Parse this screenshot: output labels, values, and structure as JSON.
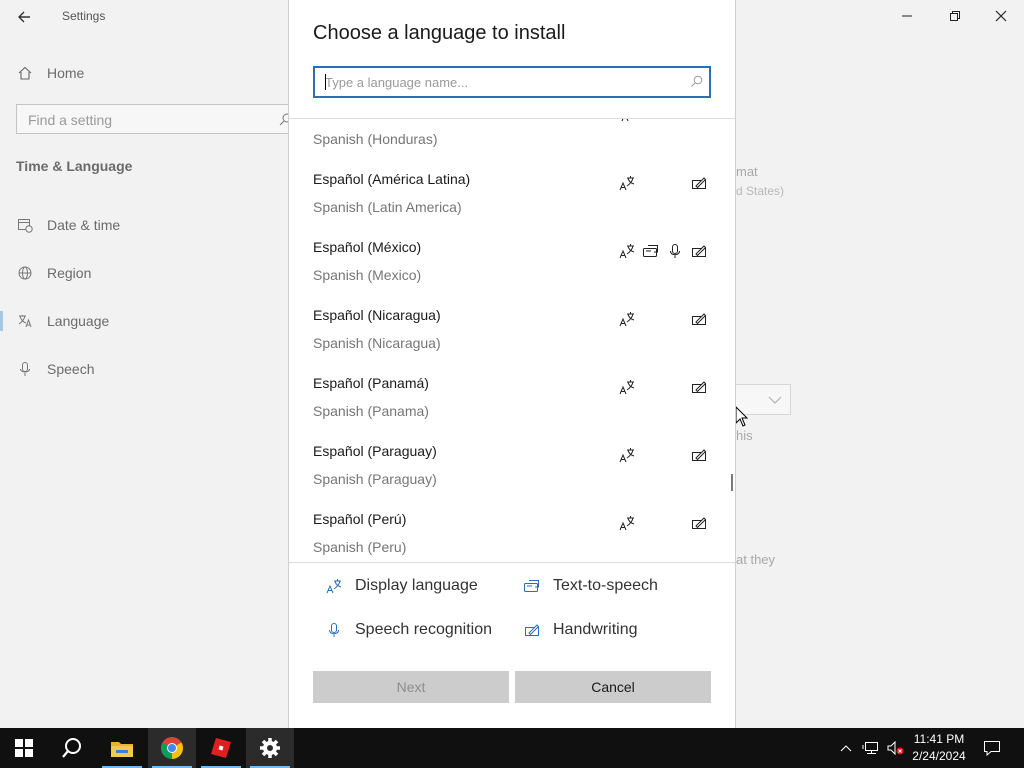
{
  "app": {
    "title": "Settings"
  },
  "sidebar": {
    "home_label": "Home",
    "find_placeholder": "Find a setting",
    "section_title": "Time & Language",
    "items": [
      {
        "label": "Date & time",
        "icon": "calendar-clock-icon"
      },
      {
        "label": "Region",
        "icon": "globe-icon"
      },
      {
        "label": "Language",
        "icon": "language-icon",
        "selected": true
      },
      {
        "label": "Speech",
        "icon": "microphone-icon"
      }
    ]
  },
  "background": {
    "fragment_format": "mat",
    "fragment_states": "d States)",
    "fragment_this": "his",
    "fragment_they": "at they"
  },
  "dialog": {
    "title": "Choose a language to install",
    "search_placeholder": "Type a language name...",
    "languages": [
      {
        "native": "",
        "english": "Spanish (Honduras)"
      },
      {
        "native": "Español (América Latina)",
        "english": "Spanish (Latin America)",
        "features": [
          "display",
          "handwriting"
        ]
      },
      {
        "native": "Español (México)",
        "english": "Spanish (Mexico)",
        "features": [
          "display",
          "tts",
          "speech",
          "handwriting"
        ]
      },
      {
        "native": "Español (Nicaragua)",
        "english": "Spanish (Nicaragua)",
        "features": [
          "display",
          "handwriting"
        ]
      },
      {
        "native": "Español (Panamá)",
        "english": "Spanish (Panama)",
        "features": [
          "display",
          "handwriting"
        ]
      },
      {
        "native": "Español (Paraguay)",
        "english": "Spanish (Paraguay)",
        "features": [
          "display",
          "handwriting"
        ]
      },
      {
        "native": "Español (Perú)",
        "english": "Spanish (Peru)",
        "features": [
          "display",
          "handwriting"
        ]
      }
    ],
    "legend": {
      "display": "Display language",
      "tts": "Text-to-speech",
      "speech": "Speech recognition",
      "handwriting": "Handwriting"
    },
    "next_label": "Next",
    "cancel_label": "Cancel"
  },
  "taskbar": {
    "apps": [
      "windows-start-icon",
      "search-icon",
      "file-explorer-icon",
      "chrome-icon",
      "roblox-icon",
      "settings-gear-icon"
    ],
    "time": "11:41 PM",
    "date": "2/24/2024"
  },
  "colors": {
    "accent": "#2a6fb6",
    "selection_bar": "#a8c6e6",
    "taskbar": "#101010"
  }
}
